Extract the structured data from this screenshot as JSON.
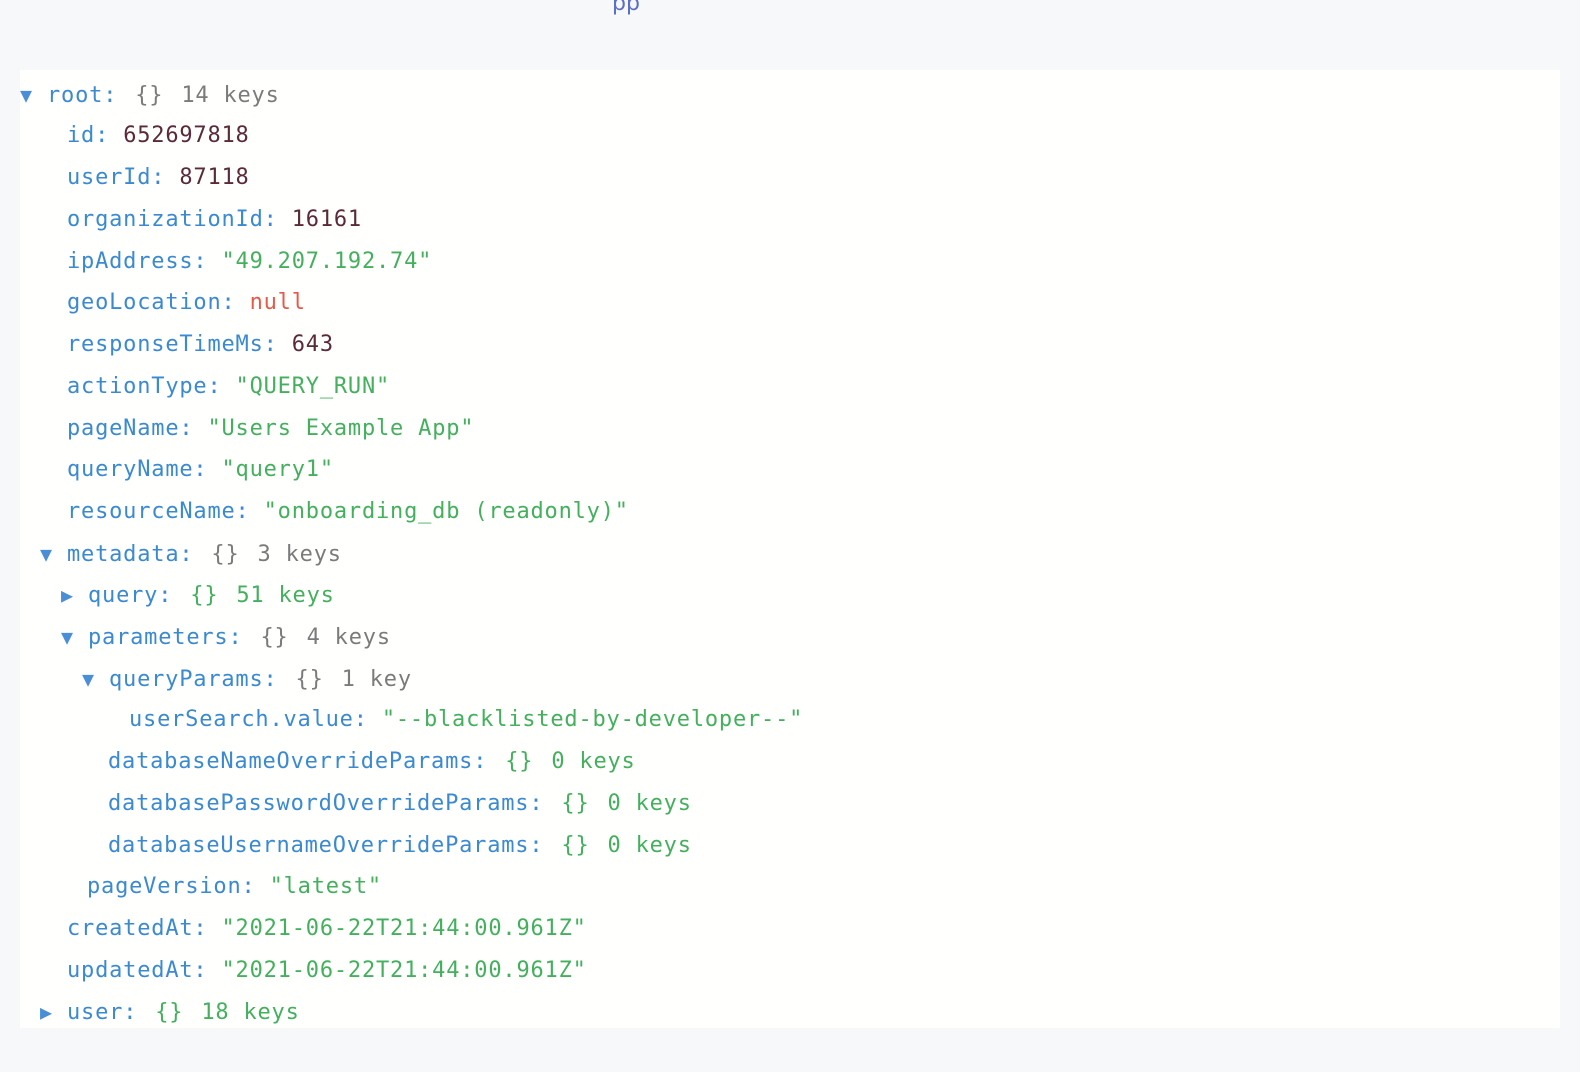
{
  "header_fragment": "pp",
  "tree": {
    "root": {
      "key": "root",
      "braces": "{}",
      "count": "14 keys"
    },
    "id": {
      "key": "id",
      "value": "652697818"
    },
    "userId": {
      "key": "userId",
      "value": "87118"
    },
    "organizationId": {
      "key": "organizationId",
      "value": "16161"
    },
    "ipAddress": {
      "key": "ipAddress",
      "value": "\"49.207.192.74\""
    },
    "geoLocation": {
      "key": "geoLocation",
      "value": "null"
    },
    "responseTimeMs": {
      "key": "responseTimeMs",
      "value": "643"
    },
    "actionType": {
      "key": "actionType",
      "value": "\"QUERY_RUN\""
    },
    "pageName": {
      "key": "pageName",
      "value": "\"Users Example App\""
    },
    "queryName": {
      "key": "queryName",
      "value": "\"query1\""
    },
    "resourceName": {
      "key": "resourceName",
      "value": "\"onboarding_db (readonly)\""
    },
    "metadata": {
      "key": "metadata",
      "braces": "{}",
      "count": "3 keys"
    },
    "query": {
      "key": "query",
      "braces": "{}",
      "count": "51 keys"
    },
    "parameters": {
      "key": "parameters",
      "braces": "{}",
      "count": "4 keys"
    },
    "queryParams": {
      "key": "queryParams",
      "braces": "{}",
      "count": "1 key"
    },
    "userSearchValue": {
      "key": "userSearch.value",
      "value": "\"--blacklisted-by-developer--\""
    },
    "databaseNameOverrideParams": {
      "key": "databaseNameOverrideParams",
      "braces": "{}",
      "count": "0 keys"
    },
    "databasePasswordOverrideParams": {
      "key": "databasePasswordOverrideParams",
      "braces": "{}",
      "count": "0 keys"
    },
    "databaseUsernameOverrideParams": {
      "key": "databaseUsernameOverrideParams",
      "braces": "{}",
      "count": "0 keys"
    },
    "pageVersion": {
      "key": "pageVersion",
      "value": "\"latest\""
    },
    "createdAt": {
      "key": "createdAt",
      "value": "\"2021-06-22T21:44:00.961Z\""
    },
    "updatedAt": {
      "key": "updatedAt",
      "value": "\"2021-06-22T21:44:00.961Z\""
    },
    "user": {
      "key": "user",
      "braces": "{}",
      "count": "18 keys"
    }
  },
  "glyphs": {
    "expanded": "▼",
    "collapsed": "▶",
    "colon": ":"
  },
  "colors": {
    "key": "#3b8ad0",
    "number": "#5a2a3a",
    "string": "#44b05e",
    "null": "#e55a4a",
    "meta": "#7b7b7b"
  }
}
